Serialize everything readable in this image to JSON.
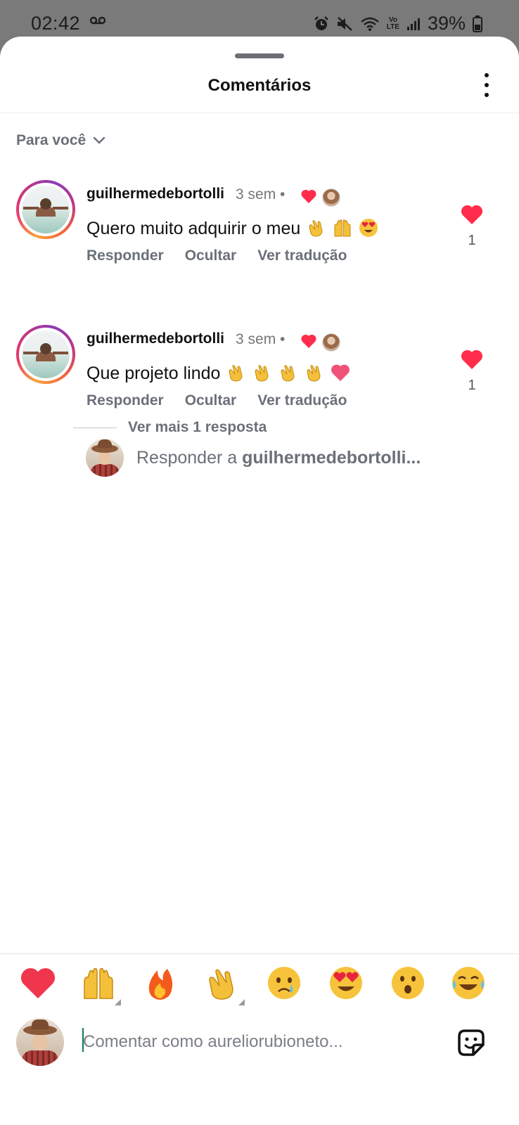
{
  "status_bar": {
    "time": "02:42",
    "battery": "39%"
  },
  "sheet": {
    "title": "Comentários",
    "filter_label": "Para você"
  },
  "comments": [
    {
      "username": "guilhermedebortolli",
      "time": "3 sem",
      "text": "Quero muito adquirir o meu",
      "emojis": [
        "clapping-hands",
        "raising-hands",
        "heart-eyes"
      ],
      "actions": [
        "Responder",
        "Ocultar",
        "Ver tradução"
      ],
      "like_count": "1"
    },
    {
      "username": "guilhermedebortolli",
      "time": "3 sem",
      "text": "Que projeto lindo",
      "emojis": [
        "clapping-hands",
        "clapping-hands",
        "clapping-hands",
        "clapping-hands",
        "pink-heart"
      ],
      "actions": [
        "Responder",
        "Ocultar",
        "Ver tradução"
      ],
      "like_count": "1"
    }
  ],
  "more_replies": "Ver mais 1 resposta",
  "reply_prompt": {
    "prefix": "Responder a ",
    "username": "guilhermedebortolli..."
  },
  "quick_reactions": [
    "red-heart",
    "raising-hands",
    "fire",
    "clapping-hands",
    "crying-face",
    "heart-eyes",
    "surprised-face",
    "tears-of-joy"
  ],
  "composer": {
    "placeholder": "Comentar como aureliorubioneto..."
  },
  "colors": {
    "accent_green": "#0a7a57",
    "like_red": "#ff2d4b",
    "muted_text": "#6b7078"
  }
}
